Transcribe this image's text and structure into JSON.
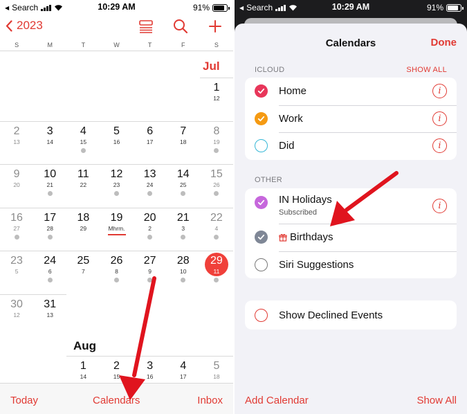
{
  "left": {
    "status": {
      "carrier": "Search",
      "time": "10:29 AM",
      "battery": "91%"
    },
    "nav": {
      "year": "2023"
    },
    "weekdays": [
      "S",
      "M",
      "T",
      "W",
      "T",
      "F",
      "S"
    ],
    "month_jul": "Jul",
    "month_aug": "Aug",
    "weeks": [
      [
        {
          "col": 6,
          "d": "1",
          "l": "12"
        }
      ],
      [
        {
          "col": 0,
          "d": "2",
          "l": "13",
          "dot": false
        },
        {
          "col": 1,
          "d": "3",
          "l": "14"
        },
        {
          "col": 2,
          "d": "4",
          "l": "15",
          "dot": true
        },
        {
          "col": 3,
          "d": "5",
          "l": "16"
        },
        {
          "col": 4,
          "d": "6",
          "l": "17"
        },
        {
          "col": 5,
          "d": "7",
          "l": "18"
        },
        {
          "col": 6,
          "d": "8",
          "l": "19",
          "dot": true
        }
      ],
      [
        {
          "col": 0,
          "d": "9",
          "l": "20"
        },
        {
          "col": 1,
          "d": "10",
          "l": "21",
          "dot": true
        },
        {
          "col": 2,
          "d": "11",
          "l": "22"
        },
        {
          "col": 3,
          "d": "12",
          "l": "23",
          "dot": true
        },
        {
          "col": 4,
          "d": "13",
          "l": "24",
          "dot": true
        },
        {
          "col": 5,
          "d": "14",
          "l": "25",
          "dot": true
        },
        {
          "col": 6,
          "d": "15",
          "l": "26",
          "dot": true
        }
      ],
      [
        {
          "col": 0,
          "d": "16",
          "l": "27",
          "dot": true
        },
        {
          "col": 1,
          "d": "17",
          "l": "28",
          "dot": true
        },
        {
          "col": 2,
          "d": "18",
          "l": "29"
        },
        {
          "col": 3,
          "d": "19",
          "l": "Mhrm.",
          "ul": true
        },
        {
          "col": 4,
          "d": "20",
          "l": "2",
          "dot": true
        },
        {
          "col": 5,
          "d": "21",
          "l": "3",
          "dot": true
        },
        {
          "col": 6,
          "d": "22",
          "l": "4",
          "dot": true
        }
      ],
      [
        {
          "col": 0,
          "d": "23",
          "l": "5"
        },
        {
          "col": 1,
          "d": "24",
          "l": "6",
          "dot": true
        },
        {
          "col": 2,
          "d": "25",
          "l": "7"
        },
        {
          "col": 3,
          "d": "26",
          "l": "8",
          "dot": true
        },
        {
          "col": 4,
          "d": "27",
          "l": "9",
          "dot": true
        },
        {
          "col": 5,
          "d": "28",
          "l": "10",
          "dot": true
        },
        {
          "col": 6,
          "d": "29",
          "l": "11",
          "today": true,
          "dot": true
        }
      ],
      [
        {
          "col": 0,
          "d": "30",
          "l": "12"
        },
        {
          "col": 1,
          "d": "31",
          "l": "13"
        }
      ],
      [
        {
          "col": 2,
          "d": "1",
          "l": "14"
        },
        {
          "col": 3,
          "d": "2",
          "l": "15"
        },
        {
          "col": 4,
          "d": "3",
          "l": "16"
        },
        {
          "col": 5,
          "d": "4",
          "l": "17"
        },
        {
          "col": 6,
          "d": "5",
          "l": "18"
        }
      ]
    ],
    "toolbar": {
      "today": "Today",
      "calendars": "Calendars",
      "inbox": "Inbox"
    }
  },
  "right": {
    "status": {
      "carrier": "Search",
      "time": "10:29 AM",
      "battery": "91%"
    },
    "title": "Calendars",
    "done": "Done",
    "icloud_header": "ICLOUD",
    "show_all_header": "SHOW ALL",
    "icloud": [
      {
        "name": "Home",
        "color": "#e8365a",
        "checked": true
      },
      {
        "name": "Work",
        "color": "#f59a12",
        "checked": true
      },
      {
        "name": "Did",
        "color": "#35b7d6",
        "checked": false
      }
    ],
    "other_header": "OTHER",
    "other": [
      {
        "name": "IN Holidays",
        "sub": "Subscribed",
        "color": "#c667dc",
        "checked": true,
        "info": true
      },
      {
        "name": "Birthdays",
        "color": "#7f8796",
        "checked": true,
        "gift": true
      },
      {
        "name": "Siri Suggestions",
        "color": "#777777",
        "checked": false
      }
    ],
    "declined": {
      "name": "Show Declined Events",
      "color": "#e13a33"
    },
    "bottom": {
      "add": "Add Calendar",
      "show_all": "Show All"
    }
  },
  "colors": {
    "accent": "#e13a33",
    "today": "#f0403a",
    "arrow": "#e0141e"
  }
}
